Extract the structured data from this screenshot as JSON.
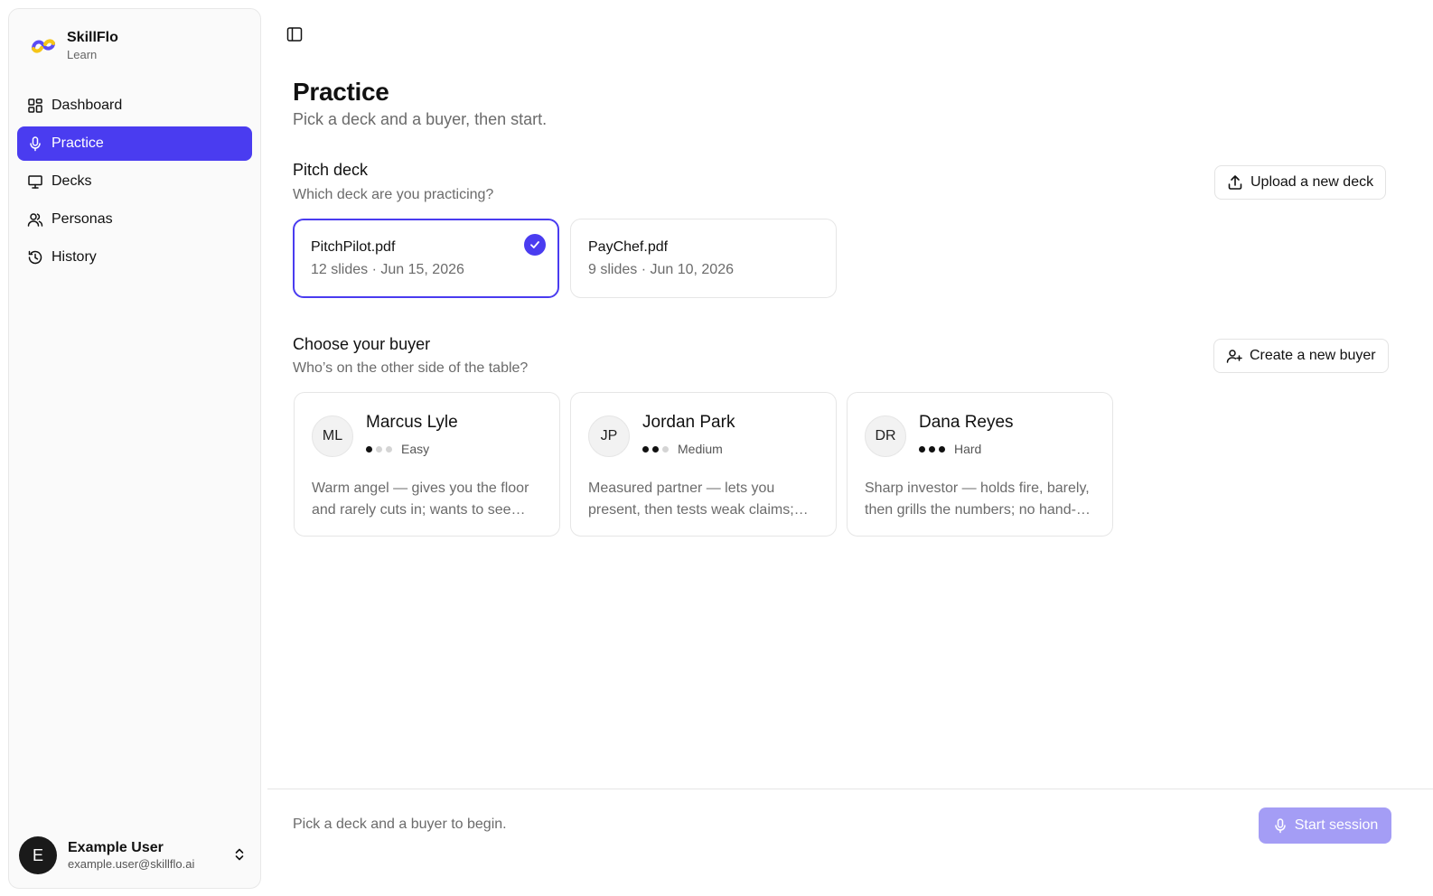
{
  "brand": {
    "name": "SkillFlo",
    "sub": "Learn",
    "logo_icon": "skillflo-logo-icon"
  },
  "sidebar": {
    "items": [
      {
        "label": "Dashboard",
        "icon": "grid-icon",
        "active": false
      },
      {
        "label": "Practice",
        "icon": "microphone-icon",
        "active": true
      },
      {
        "label": "Decks",
        "icon": "presentation-icon",
        "active": false
      },
      {
        "label": "Personas",
        "icon": "users-icon",
        "active": false
      },
      {
        "label": "History",
        "icon": "history-icon",
        "active": false
      }
    ],
    "user": {
      "initial": "E",
      "name": "Example User",
      "email": "example.user@skillflo.ai"
    }
  },
  "main": {
    "title": "Practice",
    "subtitle": "Pick a deck and a buyer, then start.",
    "deck_section": {
      "title": "Pitch deck",
      "subtitle": "Which deck are you practicing?",
      "upload_label": "Upload a new deck",
      "decks": [
        {
          "name": "PitchPilot.pdf",
          "meta": "12 slides · Jun 15, 2026",
          "selected": true
        },
        {
          "name": "PayChef.pdf",
          "meta": "9 slides · Jun 10, 2026",
          "selected": false
        }
      ]
    },
    "buyer_section": {
      "title": "Choose your buyer",
      "subtitle": "Who’s on the other side of the table?",
      "create_label": "Create a new buyer",
      "buyers": [
        {
          "initials": "ML",
          "name": "Marcus Lyle",
          "level": "Easy",
          "difficulty": 1,
          "description": "Warm angel — gives you the floor and rarely cuts in; wants to see…"
        },
        {
          "initials": "JP",
          "name": "Jordan Park",
          "level": "Medium",
          "difficulty": 2,
          "description": "Measured partner — lets you present, then tests weak claims;…"
        },
        {
          "initials": "DR",
          "name": "Dana Reyes",
          "level": "Hard",
          "difficulty": 3,
          "description": "Sharp investor — holds fire, barely, then grills the numbers; no hand-…"
        }
      ]
    },
    "footer": {
      "hint": "Pick a deck and a buyer to begin.",
      "start_label": "Start session"
    }
  },
  "colors": {
    "accent": "#4a3cf0",
    "start_disabled": "#a49df5",
    "muted_text": "#6b6b6b"
  }
}
